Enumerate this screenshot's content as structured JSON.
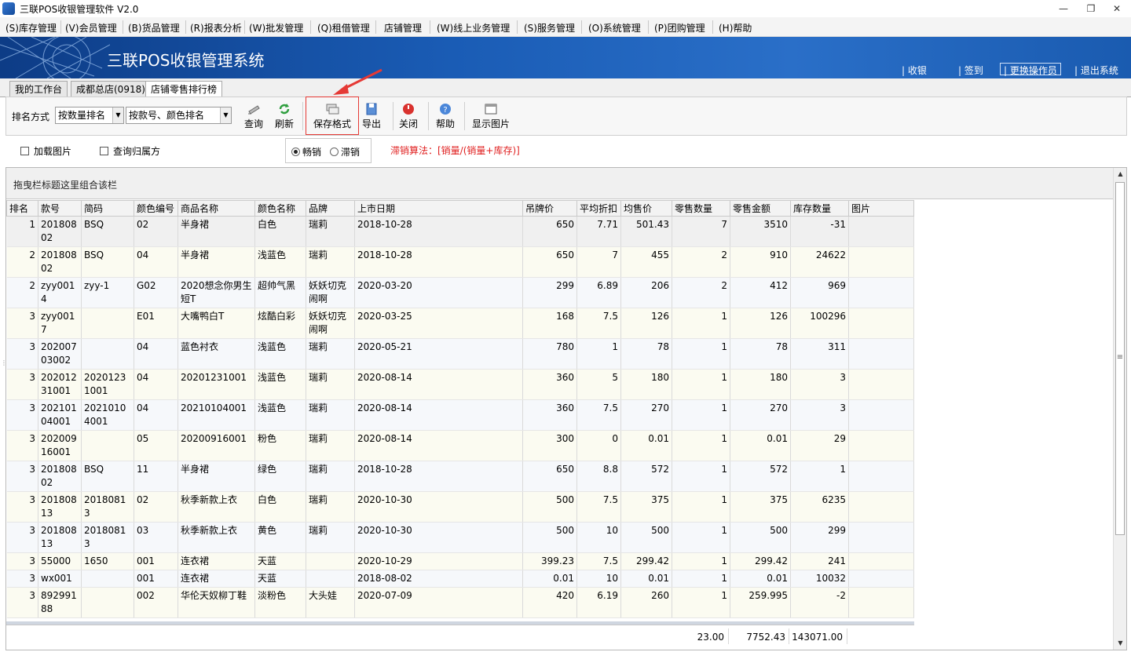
{
  "window": {
    "title": "三联POS收银管理软件 V2.0",
    "minimize": "—",
    "restore": "❐",
    "close": "✕"
  },
  "menu": [
    "(S)库存管理",
    "(V)会员管理",
    "(B)货品管理",
    "(R)报表分析",
    "(W)批发管理",
    "(Q)租借管理",
    "店铺管理",
    "(W)线上业务管理",
    "(S)服务管理",
    "(O)系统管理",
    "(P)团购管理",
    "(H)帮助"
  ],
  "banner": {
    "title": "三联POS收银管理系统",
    "nav": [
      "| 收银",
      "| 签到",
      "| 更换操作员",
      "| 退出系统"
    ],
    "active_nav": 2
  },
  "tabs": [
    "我的工作台",
    "成都总店(0918)",
    "店铺零售排行榜"
  ],
  "active_tab": 2,
  "toolbar": {
    "sort_label": "排名方式",
    "sort_value": "按数量排名",
    "group_value": "按款号、颜色排名",
    "buttons": [
      "查询",
      "刷新",
      "保存格式",
      "导出",
      "关闭",
      "帮助",
      "显示图片"
    ],
    "highlighted_button": "保存格式",
    "colors": {
      "highlight": "#e53935",
      "arrow": "#e53935"
    }
  },
  "options": {
    "load_image": "加载图片",
    "query_owner": "查询归属方",
    "radio_hot": "畅销",
    "radio_slow": "滞销",
    "radio_selected": "畅销",
    "formula": "滞销算法：[销量/(销量+库存)]"
  },
  "grid": {
    "group_hint": "拖曳栏标题这里组合该栏",
    "columns": [
      "排名",
      "款号",
      "简码",
      "颜色编号",
      "商品名称",
      "颜色名称",
      "品牌",
      "上市日期",
      "吊牌价",
      "平均折扣",
      "均售价",
      "零售数量",
      "零售金额",
      "库存数量",
      "图片"
    ],
    "rows": [
      [
        "1",
        "20180802",
        "BSQ",
        "02",
        "半身裙",
        "白色",
        "瑞莉",
        "2018-10-28",
        "650",
        "7.71",
        "501.43",
        "7",
        "3510",
        "-31",
        ""
      ],
      [
        "2",
        "20180802",
        "BSQ",
        "04",
        "半身裙",
        "浅蓝色",
        "瑞莉",
        "2018-10-28",
        "650",
        "7",
        "455",
        "2",
        "910",
        "24622",
        ""
      ],
      [
        "2",
        "zyy0014",
        "zyy-1",
        "G02",
        "2020想念你男生短T",
        "超帅气黑",
        "妖妖切克闹啊",
        "2020-03-20",
        "299",
        "6.89",
        "206",
        "2",
        "412",
        "969",
        ""
      ],
      [
        "3",
        "zyy0017",
        "",
        "E01",
        "大嘴鸭白T",
        "炫酷白彩",
        "妖妖切克闹啊",
        "2020-03-25",
        "168",
        "7.5",
        "126",
        "1",
        "126",
        "100296",
        ""
      ],
      [
        "3",
        "20200703002",
        "",
        "04",
        "蓝色衬衣",
        "浅蓝色",
        "瑞莉",
        "2020-05-21",
        "780",
        "1",
        "78",
        "1",
        "78",
        "311",
        ""
      ],
      [
        "3",
        "20201231001",
        "20201231001",
        "04",
        "20201231001",
        "浅蓝色",
        "瑞莉",
        "2020-08-14",
        "360",
        "5",
        "180",
        "1",
        "180",
        "3",
        ""
      ],
      [
        "3",
        "20210104001",
        "20210104001",
        "04",
        "20210104001",
        "浅蓝色",
        "瑞莉",
        "2020-08-14",
        "360",
        "7.5",
        "270",
        "1",
        "270",
        "3",
        ""
      ],
      [
        "3",
        "20200916001",
        "",
        "05",
        "20200916001",
        "粉色",
        "瑞莉",
        "2020-08-14",
        "300",
        "0",
        "0.01",
        "1",
        "0.01",
        "29",
        ""
      ],
      [
        "3",
        "20180802",
        "BSQ",
        "11",
        "半身裙",
        "绿色",
        "瑞莉",
        "2018-10-28",
        "650",
        "8.8",
        "572",
        "1",
        "572",
        "1",
        ""
      ],
      [
        "3",
        "20180813",
        "20180813",
        "02",
        "秋季新款上衣",
        "白色",
        "瑞莉",
        "2020-10-30",
        "500",
        "7.5",
        "375",
        "1",
        "375",
        "6235",
        ""
      ],
      [
        "3",
        "20180813",
        "20180813",
        "03",
        "秋季新款上衣",
        "黄色",
        "瑞莉",
        "2020-10-30",
        "500",
        "10",
        "500",
        "1",
        "500",
        "299",
        ""
      ],
      [
        "3",
        "55000",
        "1650",
        "001",
        "连衣裙",
        "天蓝",
        "",
        "2020-10-29",
        "399.23",
        "7.5",
        "299.42",
        "1",
        "299.42",
        "241",
        ""
      ],
      [
        "3",
        "wx001",
        "",
        "001",
        "连衣裙",
        "天蓝",
        "",
        "2018-08-02",
        "0.01",
        "10",
        "0.01",
        "1",
        "0.01",
        "10032",
        ""
      ],
      [
        "3",
        "89299188",
        "",
        "002",
        "华伦天奴柳丁鞋",
        "淡粉色",
        "大头娃",
        "2020-07-09",
        "420",
        "6.19",
        "260",
        "1",
        "259.995",
        "-2",
        ""
      ]
    ],
    "totals": {
      "qty": "23.00",
      "amount": "7752.43",
      "stock": "143071.00"
    }
  }
}
